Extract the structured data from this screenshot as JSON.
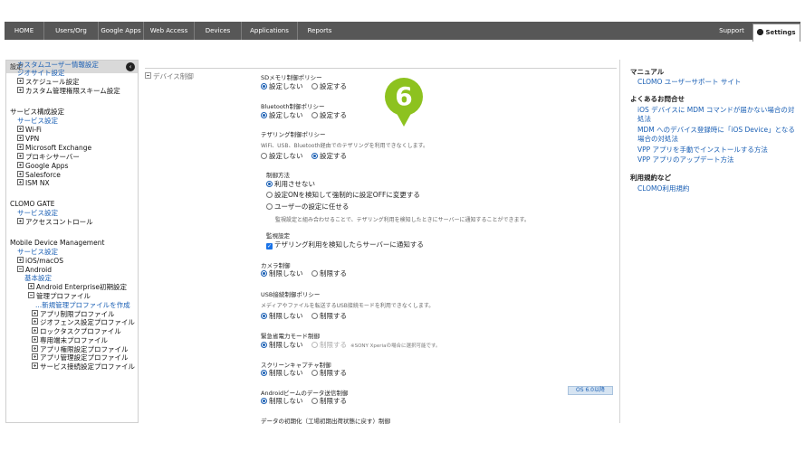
{
  "topnav": {
    "items": [
      "HOME",
      "Users/Org",
      "Google Apps",
      "Web Access",
      "Devices",
      "Applications",
      "Reports"
    ],
    "support": "Support",
    "settings": "Settings"
  },
  "sidebar": {
    "header": "設定",
    "collapse_icon": "chevron-left-icon",
    "items": [
      {
        "text": "全般",
        "kind": "sec"
      },
      {
        "text": "基本情報",
        "kind": "lnk"
      },
      {
        "text": "CLOMOアカウント設定",
        "kind": "lnk"
      },
      {
        "text": "カスタムユーザー情報設定",
        "kind": "lnk"
      },
      {
        "text": "ジオサイト設定",
        "kind": "lnk"
      },
      {
        "text": "スケジュール設定",
        "kind": "tree"
      },
      {
        "text": "カスタム管理権限スキーム設定",
        "kind": "tree"
      },
      {
        "text": "サービス構成設定",
        "kind": "sec"
      },
      {
        "text": "サービス設定",
        "kind": "lnk"
      },
      {
        "text": "Wi-Fi",
        "kind": "tree"
      },
      {
        "text": "VPN",
        "kind": "tree"
      },
      {
        "text": "Microsoft Exchange",
        "kind": "tree"
      },
      {
        "text": "プロキシサーバー",
        "kind": "tree"
      },
      {
        "text": "Google Apps",
        "kind": "tree"
      },
      {
        "text": "Salesforce",
        "kind": "tree"
      },
      {
        "text": "ISM NX",
        "kind": "tree"
      },
      {
        "text": "CLOMO GATE",
        "kind": "sec"
      },
      {
        "text": "サービス設定",
        "kind": "lnk"
      },
      {
        "text": "アクセスコントロール",
        "kind": "tree"
      },
      {
        "text": "Mobile Device Management",
        "kind": "sec"
      },
      {
        "text": "サービス設定",
        "kind": "lnk"
      },
      {
        "text": "iOS/macOS",
        "kind": "tree"
      },
      {
        "text": "Android",
        "kind": "tree-open"
      },
      {
        "text": "基本設定",
        "kind": "lnk"
      },
      {
        "text": "Android Enterprise初期設定",
        "kind": "tree"
      },
      {
        "text": "管理プロファイル",
        "kind": "tree-open"
      },
      {
        "text": "...新規管理プロファイルを作成",
        "kind": "lnk"
      },
      {
        "text": "アプリ制限プロファイル",
        "kind": "tree"
      },
      {
        "text": "ジオフェンス設定プロファイル",
        "kind": "tree"
      },
      {
        "text": "ロックタスクプロファイル",
        "kind": "tree"
      },
      {
        "text": "専用端末プロファイル",
        "kind": "tree"
      },
      {
        "text": "アプリ権限設定プロファイル",
        "kind": "tree"
      },
      {
        "text": "アプリ管理設定プロファイル",
        "kind": "tree"
      },
      {
        "text": "サービス接続設定プロファイル",
        "kind": "tree"
      }
    ]
  },
  "main": {
    "section_title": "デバイス制御",
    "step_marker": "6",
    "sd": {
      "label": "SDメモリ制御ポリシー",
      "opt1": "設定しない",
      "opt2": "設定する"
    },
    "bt": {
      "label": "Bluetooth制御ポリシー",
      "opt1": "設定しない",
      "opt2": "設定する"
    },
    "tether": {
      "label": "テザリング制御ポリシー",
      "desc": "WiFi、USB、Bluetooth経由でのテザリングを利用できなくします。",
      "opt1": "設定しない",
      "opt2": "設定する",
      "method_label": "制御方法",
      "m1": "利用させない",
      "m2": "設定ONを検知して強制的に設定OFFに変更する",
      "m3": "ユーザーの設定に任せる",
      "m_desc": "監視設定と組み合わせることで、テザリング利用を検知したときにサーバーに通知することができます。",
      "monitor_label": "監視設定",
      "monitor_opt": "テザリング利用を検知したらサーバーに通知する"
    },
    "camera": {
      "label": "カメラ制御",
      "opt1": "制限しない",
      "opt2": "制限する"
    },
    "usb": {
      "label": "USB接続制御ポリシー",
      "desc": "メディアやファイルを転送するUSB接続モードを利用できなくします。",
      "opt1": "制限しない",
      "opt2": "制限する"
    },
    "power": {
      "label": "緊急省電力モード制御",
      "opt1": "制限しない",
      "opt2": "制限する",
      "note": "※SONY Xperiaの場合に選択可能です。"
    },
    "capture": {
      "label": "スクリーンキャプチャ制御",
      "opt1": "制限しない",
      "opt2": "制限する"
    },
    "beam": {
      "label": "Androidビームのデータ送信制御",
      "opt1": "制限しない",
      "opt2": "制限する",
      "badge": "OS 6.0以降"
    },
    "reset": {
      "label": "データの初期化（工場初期出荷状態に戻す）制御"
    }
  },
  "right": {
    "manual_heading": "マニュアル",
    "manual_link": "CLOMO ユーザーサポート サイト",
    "faq_heading": "よくあるお問合せ",
    "faq": [
      "iOS デバイスに MDM コマンドが届かない場合の対",
      "処法",
      "MDM へのデバイス登録時に「iOS Device」となる",
      "場合の対処法",
      "VPP アプリを手動でインストールする方法",
      "VPP アプリのアップデート方法"
    ],
    "terms_heading": "利用規約など",
    "terms_link": "CLOMO利用規約"
  }
}
